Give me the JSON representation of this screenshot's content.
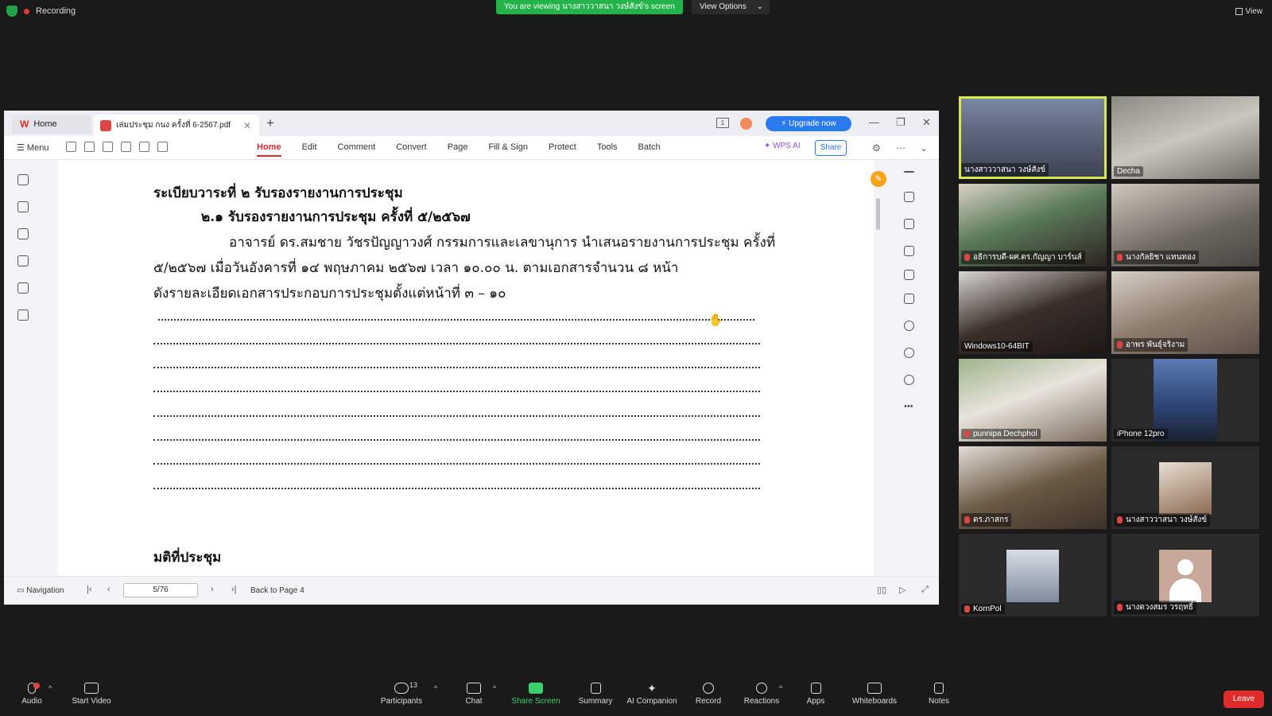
{
  "zoom_top": {
    "recording_label": "Recording",
    "viewing_banner": "You are viewing นางสาววาสนา วงษ์สังข์'s screen",
    "view_options_label": "View Options",
    "view_label": "View"
  },
  "wps": {
    "home_tab": "Home",
    "doc_tab": "เล่มประชุม กนง ครั้งที่ 6-2567.pdf",
    "upgrade_label": "Upgrade now",
    "menu_label": "Menu",
    "ribbon": [
      "Home",
      "Edit",
      "Comment",
      "Convert",
      "Page",
      "Fill & Sign",
      "Protect",
      "Tools",
      "Batch"
    ],
    "wps_ai_label": "WPS AI",
    "share_label": "Share",
    "document": {
      "heading1": "ระเบียบวาระที่ ๒   รับรองรายงานการประชุม",
      "heading2": "๒.๑ รับรองรายงานการประชุม ครั้งที่ ๕/๒๕๖๗",
      "para1": "อาจารย์ ดร.สมชาย วัชรปัญญาวงศ์ กรรมการและเลขานุการ นำเสนอรายงานการประชุม ครั้งที่",
      "para2": "๕/๒๕๖๗ เมื่อวันอังคารที่ ๑๔ พฤษภาคม ๒๕๖๗ เวลา ๑๐.๐๐ น. ตามเอกสารจำนวน ๘ หน้า",
      "para3": "ดังรายละเอียดเอกสารประกอบการประชุมตั้งแต่หน้าที่ ๓ – ๑๐",
      "resolution_heading": "มติที่ประชุม"
    },
    "status": {
      "navigation_label": "Navigation",
      "page_value": "5/76",
      "back_to_page": "Back to Page 4"
    }
  },
  "participants": [
    {
      "name": "นางสาววาสนา วงษ์สังข์",
      "muted": false
    },
    {
      "name": "Decha",
      "muted": false
    },
    {
      "name": "อธิการบดี-ผศ.ดร.กัญญา บาร์นส์",
      "muted": true
    },
    {
      "name": "นางกัลยิชา แทนทอง",
      "muted": true
    },
    {
      "name": "Windows10-64BIT",
      "muted": false
    },
    {
      "name": "อาพร พันธุ์จริงาม",
      "muted": true
    },
    {
      "name": "punnipa Dechphol",
      "muted": true
    },
    {
      "name": "iPhone 12pro",
      "muted": false
    },
    {
      "name": "ดร.ภาสกร",
      "muted": true
    },
    {
      "name": "นางสาววาสนา วงษ์สังข์",
      "muted": true
    },
    {
      "name": "KornPol",
      "muted": true
    },
    {
      "name": "นางดวงสมร วรฤทธิ์",
      "muted": true
    }
  ],
  "toolbar": {
    "audio": "Audio",
    "start_video": "Start Video",
    "participants": "Participants",
    "participants_count": "13",
    "chat": "Chat",
    "share_screen": "Share Screen",
    "summary": "Summary",
    "ai_companion": "AI Companion",
    "record": "Record",
    "reactions": "Reactions",
    "apps": "Apps",
    "whiteboards": "Whiteboards",
    "notes": "Notes",
    "leave": "Leave"
  },
  "colors": {
    "accent_green": "#24b24b",
    "wps_red": "#d92c2c",
    "upgrade_blue": "#2b7bf0",
    "active_speaker": "#d8e84a",
    "leave_red": "#e02b2b"
  }
}
